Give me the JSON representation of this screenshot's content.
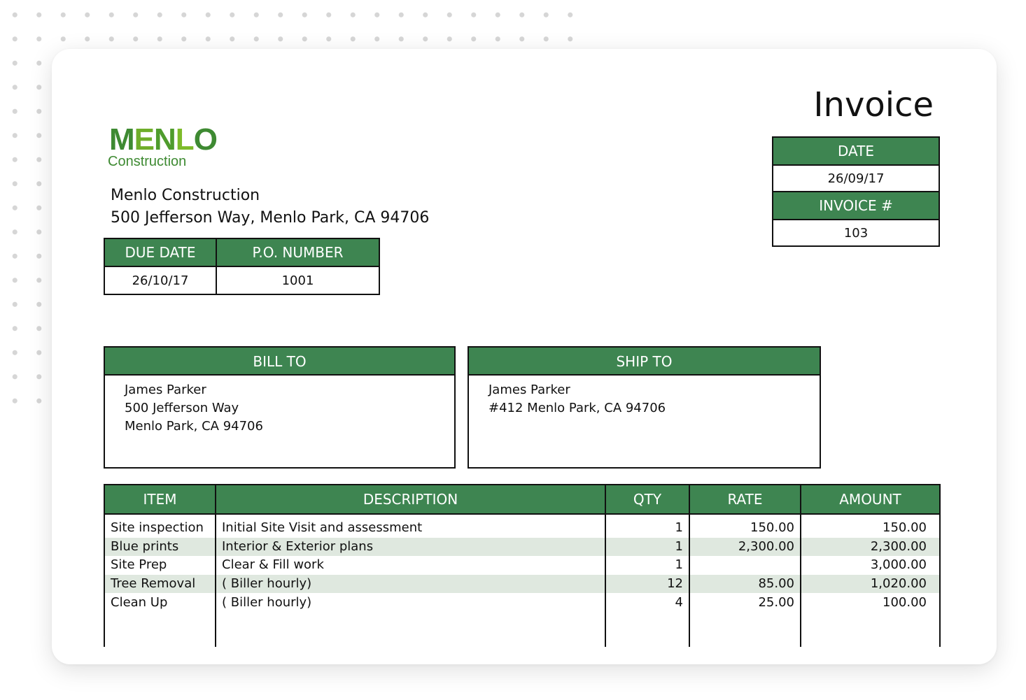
{
  "document": {
    "title": "Invoice"
  },
  "logo": {
    "letters": [
      "M",
      "E",
      "N",
      "L",
      "O"
    ],
    "subtitle": "Construction"
  },
  "company": {
    "name": "Menlo Construction",
    "address": "500 Jefferson Way, Menlo Park, CA 94706"
  },
  "meta": {
    "date_label": "DATE",
    "date_value": "26/09/17",
    "invoice_label": "INVOICE #",
    "invoice_value": "103"
  },
  "due": {
    "due_date_label": "DUE DATE",
    "due_date_value": "26/10/17",
    "po_label": "P.O. NUMBER",
    "po_value": "1001"
  },
  "bill_to": {
    "label": "BILL TO",
    "lines": [
      "James Parker",
      "500 Jefferson Way",
      "Menlo Park, CA 94706"
    ]
  },
  "ship_to": {
    "label": "SHIP TO",
    "lines": [
      "James Parker",
      "#412 Menlo Park, CA 94706"
    ]
  },
  "items": {
    "headers": [
      "ITEM",
      "DESCRIPTION",
      "QTY",
      "RATE",
      "AMOUNT"
    ],
    "rows": [
      {
        "item": "Site inspection",
        "description": "Initial Site Visit and assessment",
        "qty": "1",
        "rate": "150.00",
        "amount": "150.00"
      },
      {
        "item": "Blue prints",
        "description": "Interior & Exterior plans",
        "qty": "1",
        "rate": "2,300.00",
        "amount": "2,300.00"
      },
      {
        "item": "Site Prep",
        "description": "Clear & Fill work",
        "qty": "1",
        "rate": "",
        "amount": "3,000.00"
      },
      {
        "item": "Tree Removal",
        "description": "( Biller hourly)",
        "qty": "12",
        "rate": "85.00",
        "amount": "1,020.00"
      },
      {
        "item": "Clean Up",
        "description": "( Biller hourly)",
        "qty": "4",
        "rate": "25.00",
        "amount": "100.00"
      }
    ]
  },
  "colors": {
    "header_green": "#3e8551",
    "row_stripe": "#dfe8df",
    "logo_green": "#3e8a32"
  }
}
